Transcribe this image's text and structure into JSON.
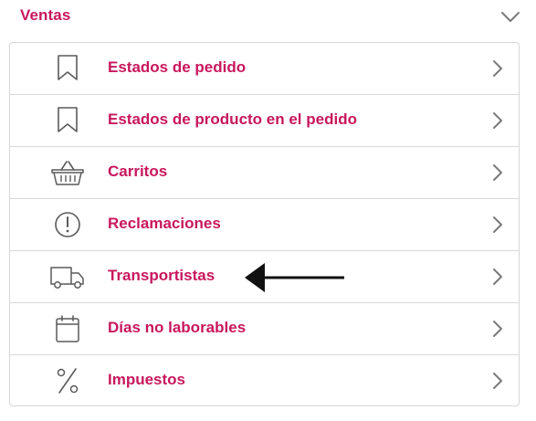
{
  "section": {
    "title": "Ventas"
  },
  "menu": {
    "items": [
      {
        "label": "Estados de pedido",
        "icon": "bookmark-icon"
      },
      {
        "label": "Estados de producto en el pedido",
        "icon": "bookmark-icon"
      },
      {
        "label": "Carritos",
        "icon": "basket-icon"
      },
      {
        "label": "Reclamaciones",
        "icon": "exclamation-circle-icon"
      },
      {
        "label": "Transportistas",
        "icon": "truck-icon"
      },
      {
        "label": "Días no laborables",
        "icon": "calendar-icon"
      },
      {
        "label": "Impuestos",
        "icon": "percent-icon"
      }
    ]
  },
  "colors": {
    "accent": "#c8175d",
    "icon": "#5a5a5a",
    "chevron": "#7a7a7a",
    "border": "#d9d9d9",
    "annotation": "#111111"
  }
}
